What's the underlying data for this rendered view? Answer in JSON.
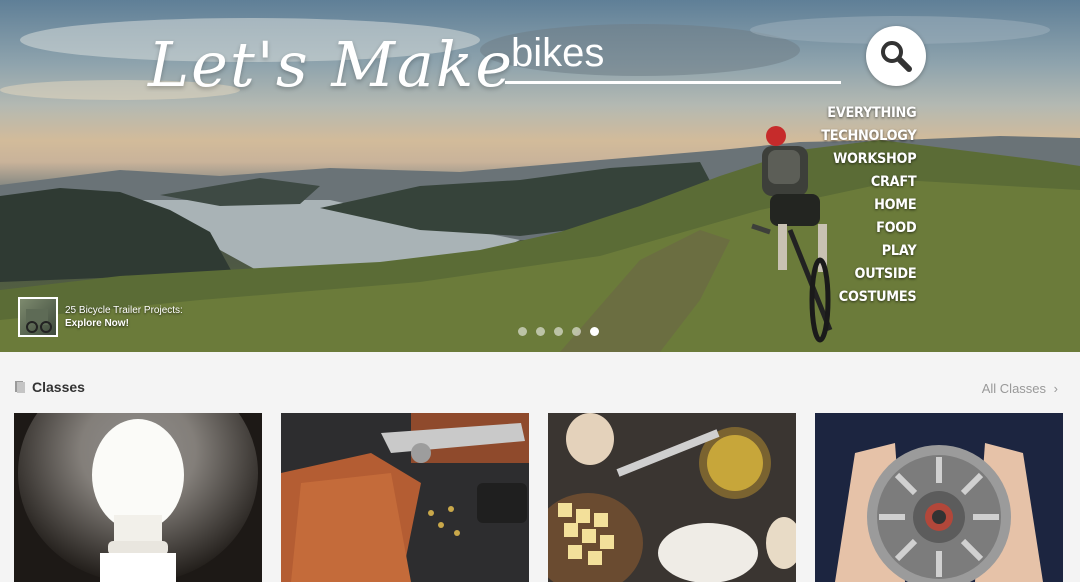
{
  "hero": {
    "title": "Let's Make",
    "search": {
      "value": "bikes"
    },
    "categories": [
      "EVERYTHING",
      "TECHNOLOGY",
      "WORKSHOP",
      "CRAFT",
      "HOME",
      "FOOD",
      "PLAY",
      "OUTSIDE",
      "COSTUMES"
    ],
    "promo": {
      "title": "25 Bicycle Trailer Projects:",
      "cta": "Explore Now!"
    },
    "slides": {
      "count": 5,
      "active_index": 4
    }
  },
  "classes": {
    "title": "Classes",
    "all_link": "All Classes",
    "cards": [
      {
        "subject": "light bulb"
      },
      {
        "subject": "leather tools"
      },
      {
        "subject": "baking ingredients"
      },
      {
        "subject": "electric motor"
      }
    ]
  },
  "icons": {
    "search": "search-icon",
    "classes": "book-icon",
    "chevron": "chevron-right-icon"
  }
}
